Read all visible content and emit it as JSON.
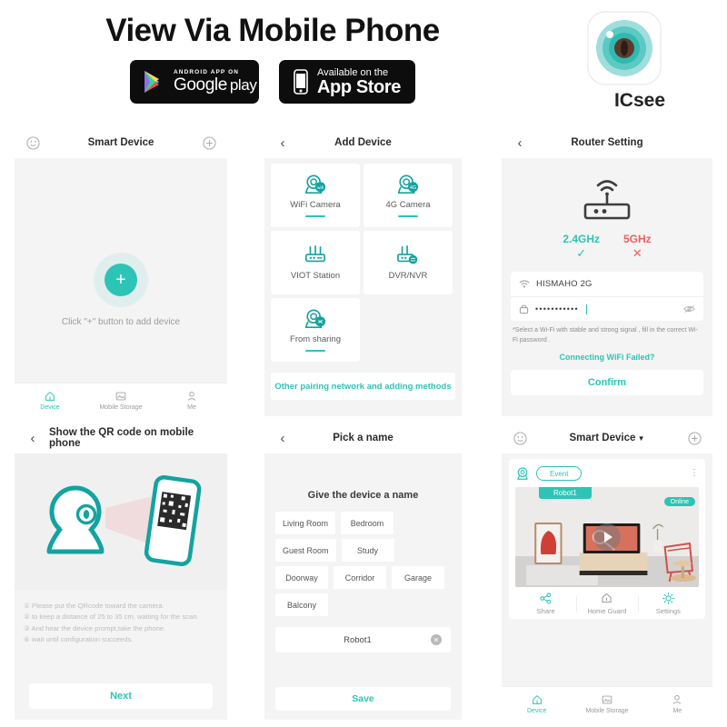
{
  "header": {
    "title": "View Via Mobile Phone",
    "badges": [
      {
        "icon": "google-play-icon",
        "small_text": "ANDROID APP ON",
        "big_text_1": "Google",
        "big_text_2": "play"
      },
      {
        "icon": "apple-iphone-icon",
        "small_text": "Available on the",
        "big_text_1": "App Store"
      }
    ],
    "app": {
      "name": "ICsee",
      "icon": "icsee-camera-lens-logo"
    }
  },
  "panels": {
    "smart_device_empty": {
      "nav": {
        "left_icon": "face-smiley-icon",
        "title": "Smart Device",
        "right_icon": "plus-circle-icon"
      },
      "add_button_glyph": "+",
      "hint": "Click \"+\" button to add device",
      "tabs": [
        {
          "icon": "device-home-icon",
          "label": "Device",
          "active": true
        },
        {
          "icon": "mobile-storage-image-icon",
          "label": "Mobile Storage",
          "active": false
        },
        {
          "icon": "person-me-icon",
          "label": "Me",
          "active": false
        }
      ]
    },
    "add_device": {
      "nav": {
        "left_icon": "back-chevron-icon",
        "title": "Add Device"
      },
      "tiles": [
        {
          "icon": "wifi-camera-icon",
          "label": "WiFi Camera"
        },
        {
          "icon": "4g-camera-icon",
          "label": "4G Camera"
        },
        {
          "icon": "viot-station-icon",
          "label": "VIOT Station"
        },
        {
          "icon": "dvr-nvr-icon",
          "label": "DVR/NVR"
        },
        {
          "icon": "from-sharing-icon",
          "label": "From sharing"
        }
      ],
      "other_methods": "Other pairing network and adding methods"
    },
    "router_setting": {
      "nav": {
        "left_icon": "back-chevron-icon",
        "title": "Router Setting"
      },
      "router_icon": "wifi-router-icon",
      "freq_supported": {
        "label": "2.4GHz",
        "mark": "✓",
        "color": "#2dc4b6"
      },
      "freq_unsupported": {
        "label": "5GHz",
        "mark": "✕",
        "color": "#ef5f5f"
      },
      "ssid": {
        "icon": "wifi-signal-icon",
        "value": "HISMAHO 2G"
      },
      "password": {
        "icon": "lock-icon",
        "value": "•••••••••••",
        "toggle_icon": "eye-slash-icon"
      },
      "note": "*Select a Wi-Fi with stable and strong signal , fill in the correct Wi-Fi password .",
      "help_link": "Connecting WiFi Failed?",
      "confirm_button": "Confirm"
    },
    "qr_code": {
      "nav": {
        "left_icon": "back-chevron-icon",
        "title": "Show the QR code on mobile phone"
      },
      "illustration": "camera-scanning-phone-qr-icon",
      "steps": [
        "① Please put the QRcode toward the camera.",
        "② to keep a distance of 25 to 35 cm, waiting for the scan.",
        "③ And hear the device prompt,take the phone.",
        "⑥ wait until configuration succeeds."
      ],
      "next_button": "Next"
    },
    "pick_a_name": {
      "nav": {
        "left_icon": "back-chevron-icon",
        "title": "Pick a name"
      },
      "subtitle": "Give the device a name",
      "suggestions": [
        "Living Room",
        "Bedroom",
        "Guest Room",
        "Study",
        "Doorway",
        "Corridor",
        "Garage",
        "Balcony"
      ],
      "name_input": {
        "value": "Robot1",
        "clear_icon": "clear-circle-x-icon"
      },
      "save_button": "Save"
    },
    "smart_device_live": {
      "nav": {
        "left_icon": "face-smiley-icon",
        "title": "Smart Device",
        "right_icon": "plus-circle-icon"
      },
      "card": {
        "camera_icon": "camera-round-icon",
        "event_button": "Event",
        "menu_icon": "kebab-menu-icon",
        "device_tag": "Robot1",
        "status_badge": "Online",
        "play_icon": "play-triangle-icon",
        "actions": [
          {
            "icon": "share-nodes-icon",
            "label": "Share"
          },
          {
            "icon": "home-guard-icon",
            "label": "Home Guard"
          },
          {
            "icon": "settings-gear-icon",
            "label": "Settings"
          }
        ]
      },
      "tabs": [
        {
          "icon": "device-home-icon",
          "label": "Device",
          "active": true
        },
        {
          "icon": "mobile-storage-image-icon",
          "label": "Mobile Storage",
          "active": false
        },
        {
          "icon": "person-me-icon",
          "label": "Me",
          "active": false
        }
      ]
    }
  },
  "colors": {
    "accent": "#2dc4b6",
    "danger": "#ef5f5f",
    "panel_bg": "#f4f4f4",
    "card_bg": "#ffffff"
  }
}
